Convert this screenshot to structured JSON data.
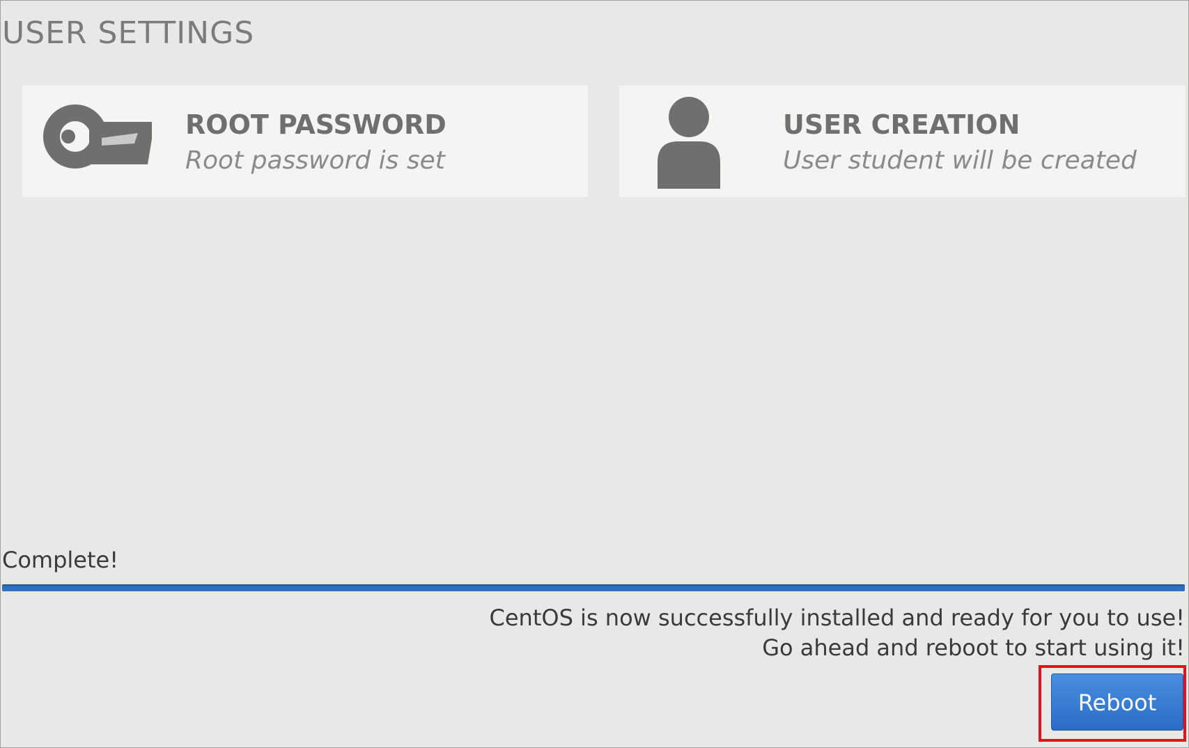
{
  "section": {
    "title": "USER SETTINGS"
  },
  "spokes": [
    {
      "name": "ROOT PASSWORD",
      "status": "Root password is set",
      "icon": "key-icon"
    },
    {
      "name": "USER CREATION",
      "status": "User student will be created",
      "icon": "user-icon"
    }
  ],
  "progress": {
    "label": "Complete!",
    "fraction": 1.0
  },
  "message": {
    "line1": "CentOS is now successfully installed and ready for you to use!",
    "line2": "Go ahead and reboot to start using it!"
  },
  "reboot": {
    "label": "Reboot"
  },
  "colors": {
    "accent": "#2f6fc2",
    "highlight": "#e0121b",
    "background": "#e8e8e7"
  }
}
